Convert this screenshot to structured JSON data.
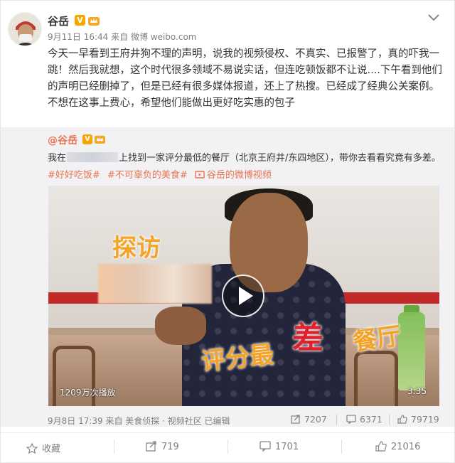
{
  "post": {
    "author": "谷岳",
    "date": "9月11日 16:44",
    "source": "来自 微博 weibo.com",
    "text": "今天一早看到王府井狗不理的声明，说我的视频侵权、不真实、已报警了，真的吓我一跳！然后我就想，这个时代很多领域不易说实话，但连吃顿饭都不让说....下午看到他们的声明已经删掉了，但是已经有很多媒体报道，还上了热搜。已经成了经典公关案例。 不想在这事上费心，希望他们能做出更好吃实惠的包子"
  },
  "repost": {
    "author": "@谷岳",
    "text_before": "我在",
    "text_after": "上找到一家评分最低的餐厅（北京王府井/东四地区），带你去看看究竟有多差。",
    "tags": [
      "#好好吃饭#",
      "#不可辜负的美食#"
    ],
    "video_link": "谷岳的微博视频",
    "video": {
      "overlay_tanfang": "探访",
      "overlay_pingfen": "评分最",
      "overlay_cha": "差",
      "overlay_canting": "餐厅",
      "plays": "1209万次播放",
      "duration": "3:35"
    },
    "meta": "9月8日 17:39 来自 美食侦探 · 视频社区  已编辑",
    "reposts": "7207",
    "comments": "6371",
    "likes": "79719"
  },
  "actions": {
    "favorite": "收藏",
    "repost": "719",
    "comment": "1701",
    "like": "21016"
  },
  "colors": {
    "accent": "#eb7350",
    "verified": "#f7a600",
    "repost_bg": "#f2f2f5"
  },
  "icons": [
    "crown-badge-icon",
    "verified-v-icon",
    "chevron-down-icon",
    "play-icon",
    "video-link-icon",
    "share-icon",
    "comment-icon",
    "like-icon",
    "star-icon"
  ]
}
